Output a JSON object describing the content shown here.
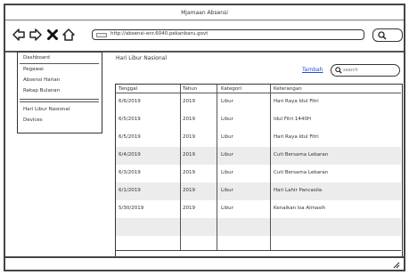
{
  "window": {
    "title": "Mjamaan Absensi"
  },
  "browser": {
    "url": "http://absensi-enr.6040.pekanbaru.govt"
  },
  "menu": {
    "items": [
      {
        "label": "Dashboard"
      },
      {
        "label": "Pegawai"
      },
      {
        "label": "Absensi Harian"
      },
      {
        "label": "Rekap Bulanan"
      },
      {
        "label": "Hari Libur Nasional"
      },
      {
        "label": "Devices"
      }
    ]
  },
  "main": {
    "title": "Hari Libur Nasional",
    "add_label": "Tambah",
    "search_placeholder": "search"
  },
  "table": {
    "columns": [
      "Tanggal",
      "Tahun",
      "Kategori",
      "Keterangan"
    ],
    "rows": [
      [
        "6/6/2019",
        "2019",
        "Libur",
        "Hari Raya Idul Fitri"
      ],
      [
        "6/5/2019",
        "2019",
        "Libur",
        "Idul Fitri 1440H"
      ],
      [
        "6/5/2019",
        "2019",
        "Libur",
        "Hari Raya Idul Fitri"
      ],
      [
        "6/4/2019",
        "2019",
        "Libur",
        "Cuti Bersama Lebaran"
      ],
      [
        "6/3/2019",
        "2019",
        "Libur",
        "Cuti Bersama Lebaran"
      ],
      [
        "6/1/2019",
        "2019",
        "Libur",
        "Hari Lahir Pancasila"
      ],
      [
        "5/30/2019",
        "2019",
        "Libur",
        "Kenaikan Isa Almasih"
      ],
      [
        "",
        "",
        "",
        ""
      ],
      [
        "",
        "",
        "",
        ""
      ]
    ]
  },
  "colors": {
    "link": "#2050c8",
    "row_alt": "#ececec",
    "border": "#333333"
  }
}
